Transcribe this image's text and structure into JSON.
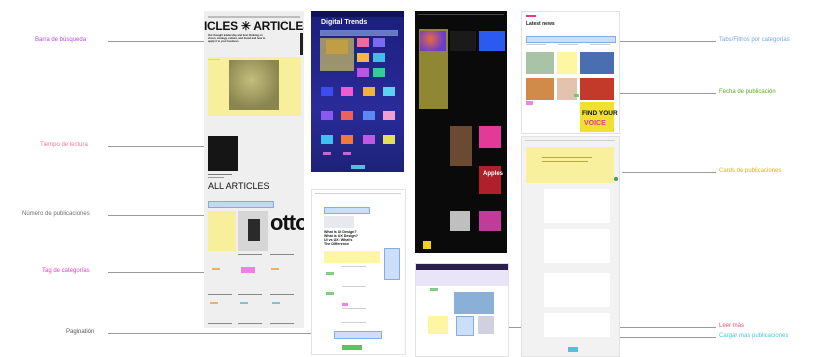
{
  "annotations": {
    "search_bar": {
      "text": "Barra de búsqueda",
      "color": "#b44fd6"
    },
    "reading_time": {
      "text": "Tiempo de lectura",
      "color": "#f07a9a"
    },
    "post_count": {
      "text": "Número de publicaciones",
      "color": "#707070"
    },
    "category_tag": {
      "text": "Tag de categorías",
      "color": "#e63fc4"
    },
    "pagination": {
      "text": "Paginatión",
      "color": "#555555"
    },
    "tabs_filters": {
      "text": "Tabs/Filtros por categorías",
      "color": "#79a6e0"
    },
    "publish_date": {
      "text": "Fecha de publicación",
      "color": "#5daa2a"
    },
    "post_cards": {
      "text": "Cards de publicaciones",
      "color": "#e0b400"
    },
    "read_more": {
      "text": "Leer más",
      "color": "#e6507d"
    },
    "load_more": {
      "text": "Cargar más publicaciones",
      "color": "#4fc3d9"
    }
  },
  "panel1": {
    "hero_title": "ICLES ✳ ARTICLES",
    "hero_sub": "Our thought leadership and best thinking on vision, strategy, culture, and brand and how to apply it to your business.",
    "all_title": "ALL ARTICLES",
    "big_text": "otto"
  },
  "panel2": {
    "title": "Digital Trends"
  },
  "panel4": {
    "title": "Latest news",
    "find_text": "FIND YOUR",
    "voice_text": "VOICE"
  },
  "panel5": {
    "headline": "What Is UI Design? What Is UX Design? UI vs UX: What's The Difference"
  },
  "panel3": {
    "headline_a": "Apples"
  },
  "colors": {
    "highlight_yellow": "#ffee5a",
    "highlight_blue": "#a0c3f5",
    "highlight_pink": "#f06edc",
    "highlight_green": "#64be64"
  }
}
